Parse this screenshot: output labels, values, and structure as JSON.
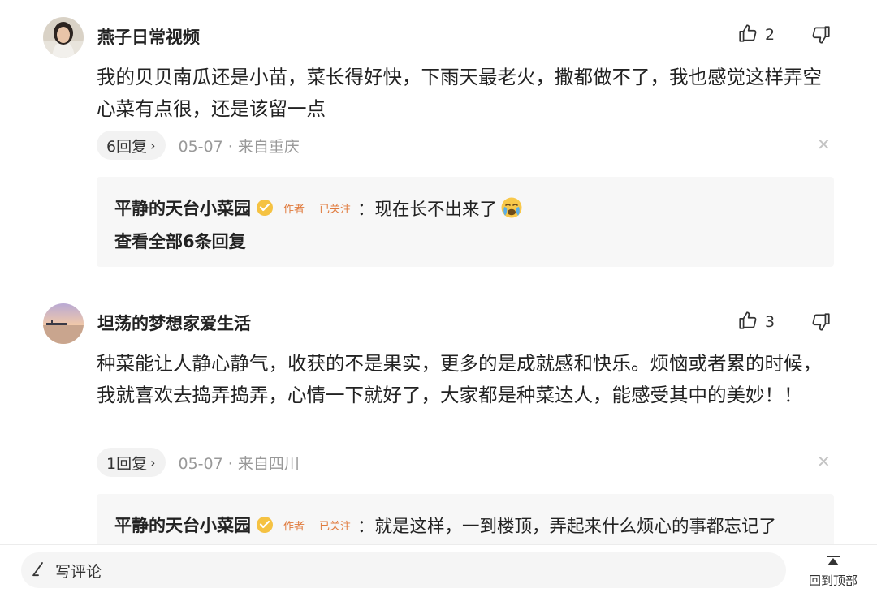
{
  "comments": [
    {
      "username": "燕子日常视频",
      "likes": "2",
      "text": "我的贝贝南瓜还是小苗，菜长得好快，下雨天最老火，撒都做不了，我也感觉这样弄空心菜有点很，还是该留一点",
      "reply_count": "6回复",
      "meta": "05-07 · 来自重庆",
      "reply": {
        "author": "平静的天台小菜园",
        "tag_author": "作者",
        "tag_followed": "已关注",
        "text": "：现在长不出来了",
        "view_all": "查看全部6条回复"
      }
    },
    {
      "username": "坦荡的梦想家爱生活",
      "likes": "3",
      "text": "种菜能让人静心静气，收获的不是果实，更多的是成就感和快乐。烦恼或者累的时候，我就喜欢去捣弄捣弄，心情一下就好了，大家都是种菜达人，能感受其中的美妙！！",
      "reply_count": "1回复",
      "meta": "05-07 · 来自四川",
      "reply": {
        "author": "平静的天台小菜园",
        "tag_author": "作者",
        "tag_followed": "已关注",
        "text": "：就是这样，一到楼顶，弄起来什么烦心的事都忘记了"
      }
    }
  ],
  "bottom_bar": {
    "comment_placeholder": "写评论",
    "back_to_top": "回到顶部"
  },
  "icons": {
    "like": "thumbs-up-icon",
    "dislike": "thumbs-down-icon",
    "close": "close-icon",
    "verified": "verified-badge-icon",
    "edit": "pencil-icon",
    "back_to_top": "arrow-up-icon"
  },
  "colors": {
    "tag": "#e07a3c",
    "verified": "#f5c242",
    "meta": "#999999",
    "reply_bg": "#f7f7f7"
  }
}
